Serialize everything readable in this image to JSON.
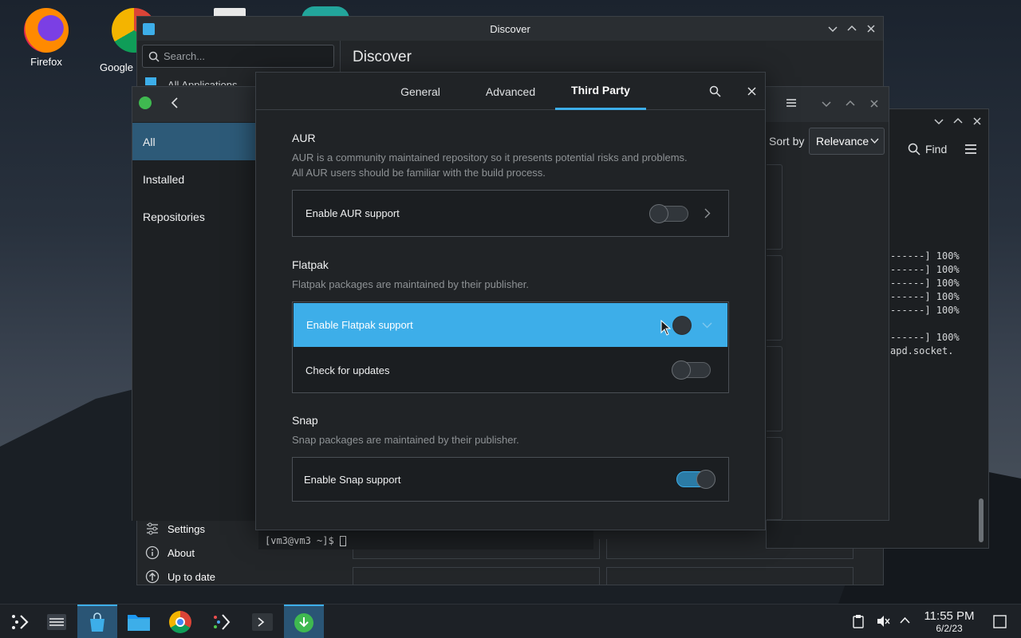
{
  "desktop": {
    "icons": [
      {
        "label": "Firefox"
      },
      {
        "label": "Google"
      }
    ]
  },
  "discover_main": {
    "title": "Discover",
    "search_placeholder": "Search...",
    "heading": "Discover",
    "nav_partial": "All Applications",
    "bottom_nav": [
      {
        "label": "Settings"
      },
      {
        "label": "About"
      },
      {
        "label": "Up to date"
      }
    ]
  },
  "discover_second": {
    "sidebar": [
      {
        "label": "All"
      },
      {
        "label": "Installed"
      },
      {
        "label": "Repositories"
      }
    ],
    "sort_label": "Sort by",
    "sort_value": "Relevance",
    "find_label": "Find"
  },
  "terminal": {
    "progress_lines": [
      "------] 100%",
      "------] 100%",
      "------] 100%",
      "------] 100%",
      "------] 100%",
      "------] 100%"
    ],
    "socket_line": "apd.socket.",
    "prompt": "[vm3@vm3 ~]$ "
  },
  "dialog": {
    "tabs": [
      {
        "label": "General"
      },
      {
        "label": "Advanced"
      },
      {
        "label": "Third Party"
      }
    ],
    "active_tab": "Third Party",
    "sections": {
      "aur": {
        "title": "AUR",
        "desc_line1": "AUR is a community maintained repository so it presents potential risks and problems.",
        "desc_line2": "All AUR users should be familiar with the build process.",
        "option": "Enable AUR support",
        "enabled": false
      },
      "flatpak": {
        "title": "Flatpak",
        "desc": "Flatpak packages are maintained by their publisher.",
        "option": "Enable Flatpak support",
        "enabled": false,
        "sub_option": "Check for updates",
        "sub_enabled": false
      },
      "snap": {
        "title": "Snap",
        "desc": "Snap packages are maintained by their publisher.",
        "option": "Enable Snap support",
        "enabled": true
      }
    }
  },
  "taskbar": {
    "time": "11:55 PM",
    "date": "6/2/23"
  },
  "colors": {
    "accent": "#3daee9",
    "window_bg": "#232629",
    "dialog_bg": "#202326"
  }
}
